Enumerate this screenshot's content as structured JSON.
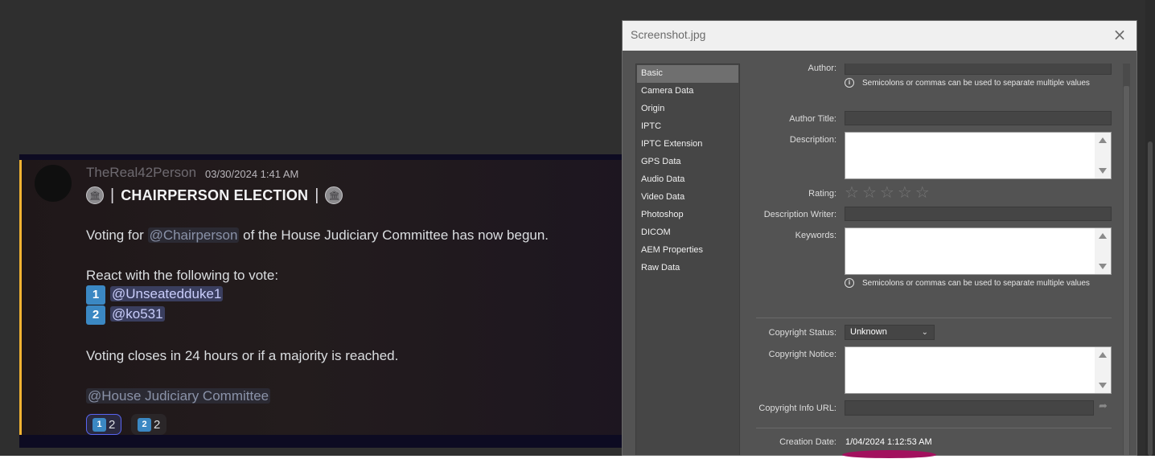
{
  "discord": {
    "username": "TheReal42Person",
    "timestamp": "03/30/2024 1:41 AM",
    "title": "CHAIRPERSON ELECTION",
    "title_separator": "|",
    "line1_prefix": "Voting for ",
    "line1_mention": "@Chairperson",
    "line1_suffix": " of the House Judiciary Committee has now begun.",
    "line2": "React with the following to vote:",
    "option1_key": "1",
    "option1_mention": "@Unseatedduke1",
    "option2_key": "2",
    "option2_mention": "@ko531",
    "line3": "Voting closes in 24 hours or if a majority is reached.",
    "role_mention": "@House Judiciary Committee",
    "reactions": [
      {
        "emoji": "1",
        "count": "2"
      },
      {
        "emoji": "2",
        "count": "2"
      }
    ],
    "seal_icon": "capitol-seal"
  },
  "dialog": {
    "title": "Screenshot.jpg",
    "close_icon": "×",
    "sidebar": [
      "Basic",
      "Camera Data",
      "Origin",
      "IPTC",
      "IPTC Extension",
      "GPS Data",
      "Audio Data",
      "Video Data",
      "Photoshop",
      "DICOM",
      "AEM Properties",
      "Raw Data"
    ],
    "selected_tab": "Basic",
    "labels": {
      "author": "Author:",
      "author_title": "Author Title:",
      "description": "Description:",
      "rating": "Rating:",
      "description_writer": "Description Writer:",
      "keywords": "Keywords:",
      "copyright_status": "Copyright Status:",
      "copyright_notice": "Copyright Notice:",
      "copyright_info_url": "Copyright Info URL:",
      "creation_date": "Creation Date:"
    },
    "hint": "Semicolons or commas can be used to separate multiple values",
    "rating_value": 0,
    "rating_max": 5,
    "copyright_status_value": "Unknown",
    "creation_date_value": "1/04/2024 1:12:53 AM"
  },
  "colors": {
    "highlight_mark": "#a2115e",
    "message_accent": "#f0b232",
    "keycap": "#3b88c3"
  }
}
